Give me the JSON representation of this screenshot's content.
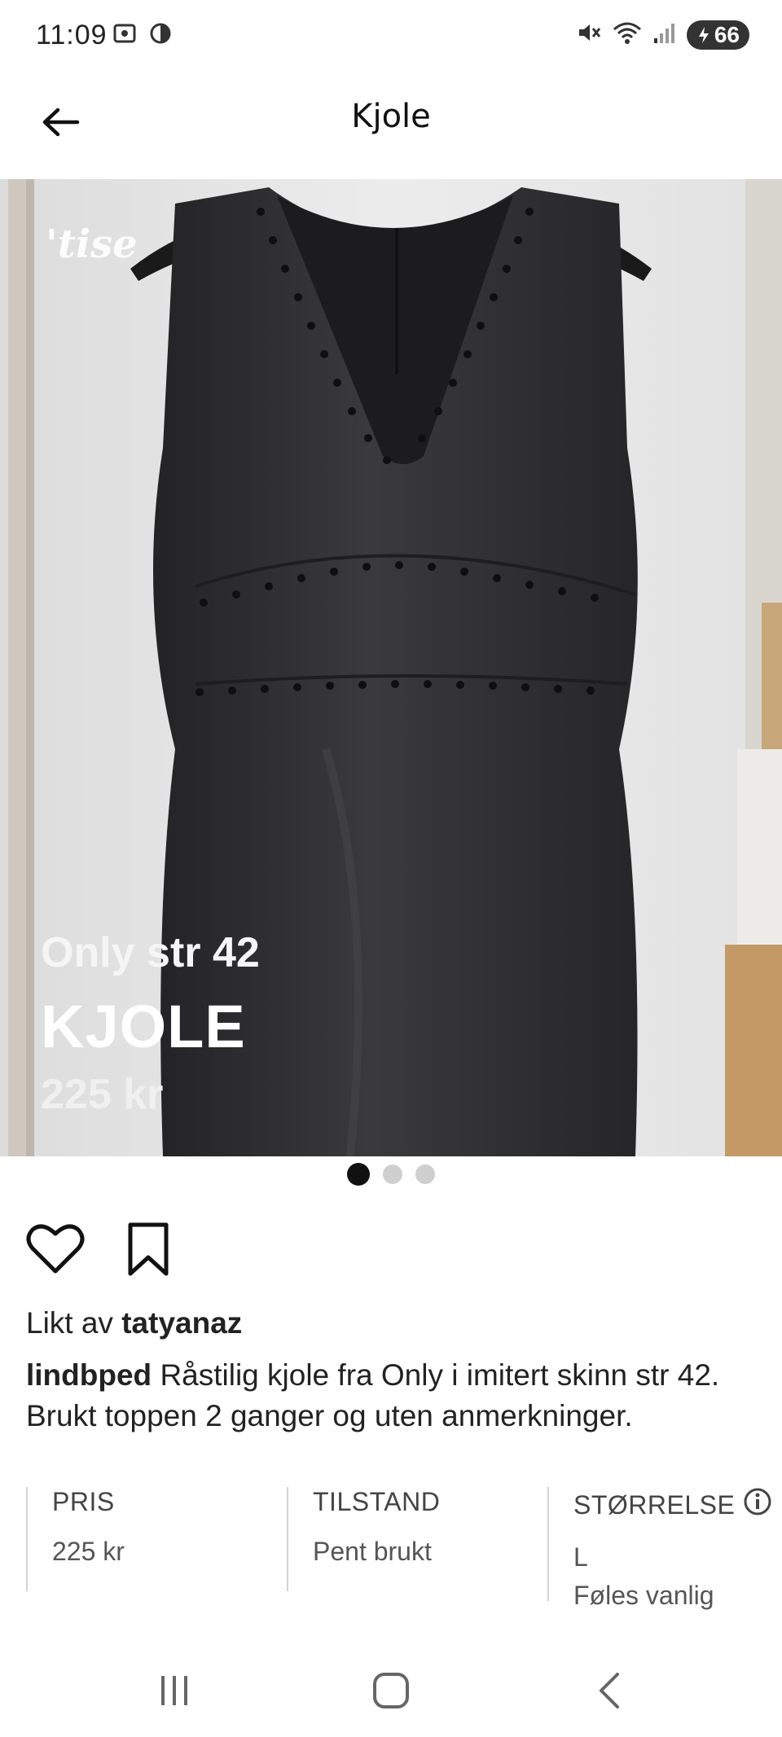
{
  "status_bar": {
    "time": "11:09",
    "battery": "66",
    "icons": [
      "screenshot-icon",
      "data-saver-icon",
      "mute-icon",
      "wifi-icon",
      "signal-icon",
      "battery-icon"
    ]
  },
  "app_bar": {
    "title": "Kjole",
    "back_icon": "arrow-left-icon"
  },
  "photo": {
    "watermark": "'tise",
    "overlay_subtitle": "Only str 42",
    "overlay_title": "KJOLE",
    "overlay_price": "225 kr"
  },
  "carousel": {
    "total": 3,
    "active_index": 0
  },
  "actions": {
    "like_icon": "heart-icon",
    "save_icon": "bookmark-icon"
  },
  "likes": {
    "prefix": "Likt av",
    "user": "tatyanaz"
  },
  "description": {
    "author": "lindbped",
    "text": "Råstilig kjole fra Only i imitert skinn str 42. Brukt toppen 2 ganger og uten anmerkninger."
  },
  "details": {
    "price_label": "PRIS",
    "price_value": "225 kr",
    "condition_label": "TILSTAND",
    "condition_value": "Pent brukt",
    "size_label": "STØRRELSE",
    "size_value": "L",
    "size_fit": "Føles vanlig",
    "size_info_icon": "info-icon"
  },
  "nav_bar": {
    "icons": [
      "recent-apps-icon",
      "home-icon",
      "back-icon"
    ]
  },
  "colors": {
    "text": "#1a1a1a",
    "dress": "#2b2b2d",
    "background": "#ffffff"
  }
}
